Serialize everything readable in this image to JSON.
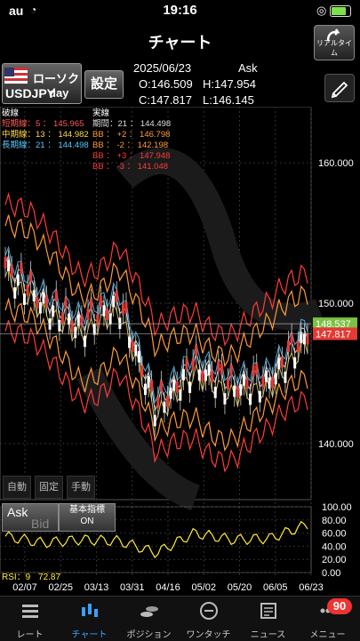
{
  "status": {
    "carrier": "au",
    "time": "19:16"
  },
  "header": {
    "title": "チャート",
    "realtime_label": "リアルタイム"
  },
  "info": {
    "symbol": "USDJPY",
    "chart_type": "ローソク",
    "period": "day",
    "settings_label": "設定",
    "date": "2025/06/23",
    "side": "Ask",
    "open": "O:146.509",
    "high": "H:147.954",
    "close": "C:147.817",
    "low": "L:146.145"
  },
  "legend_left": {
    "title": "破線",
    "items": [
      {
        "label": "短期線：5 ： 145.965",
        "color": "#ff5a5a"
      },
      {
        "label": "中期線：13 ： 144.982",
        "color": "#ffd84a"
      },
      {
        "label": "長期線：21 ： 144.498",
        "color": "#5ac8ff"
      }
    ]
  },
  "legend_right": {
    "title": "実線",
    "items": [
      {
        "label": "期間：21 ： 144.498",
        "color": "#dddddd"
      },
      {
        "label": "BB ： +2 ： 146.798",
        "color": "#ff9a3c"
      },
      {
        "label": "BB ： -2 ： 142.198",
        "color": "#ff9a3c"
      },
      {
        "label": "BB ： +3 ： 147.948",
        "color": "#ff3b3b"
      },
      {
        "label": "BB ： -3 ： 141.048",
        "color": "#ff3b3b"
      }
    ]
  },
  "price_axis": {
    "ticks": [
      {
        "value": 160,
        "label": "160.000"
      },
      {
        "value": 150,
        "label": "150.000"
      },
      {
        "value": 140,
        "label": "140.000"
      }
    ],
    "markers": [
      {
        "value": 148.537,
        "label": "148.537",
        "color": "#7bc142"
      },
      {
        "value": 147.817,
        "label": "147.817",
        "color": "#e53935"
      }
    ]
  },
  "date_axis": [
    "02/07",
    "02/25",
    "03/13",
    "03/31",
    "04/16",
    "05/02",
    "05/20",
    "06/05",
    "06/23"
  ],
  "mode_buttons": [
    "自動",
    "固定",
    "手動"
  ],
  "rsi_panel": {
    "ask_label": "Ask",
    "bid_label": "Bid",
    "indicator_label": "基本指標",
    "indicator_state": "ON",
    "rsi_period_label": "RSI：9",
    "rsi_value": "72.87",
    "ticks": [
      "100.00",
      "80.00",
      "60.00",
      "40.00",
      "20.00",
      "0.00"
    ]
  },
  "chart_data": {
    "type": "candlestick",
    "x": [
      "02/07",
      "02/25",
      "03/13",
      "03/31",
      "04/16",
      "05/02",
      "05/20",
      "06/05",
      "06/23"
    ],
    "ylim": [
      136,
      164
    ],
    "close_approx": [
      152.5,
      150.0,
      148.3,
      150.0,
      142.5,
      145.5,
      144.0,
      144.5,
      147.817
    ],
    "rsi_approx": [
      55,
      45,
      50,
      48,
      30,
      60,
      50,
      52,
      72.87
    ],
    "rsi_ylim": [
      0,
      100
    ]
  },
  "tabs": [
    {
      "label": "レート",
      "icon": "list-icon"
    },
    {
      "label": "チャート",
      "icon": "candlestick-icon",
      "active": true
    },
    {
      "label": "ポジション",
      "icon": "coins-icon"
    },
    {
      "label": "ワンタッチ",
      "icon": "sell-buy-icon"
    },
    {
      "label": "ニュース",
      "icon": "news-icon"
    },
    {
      "label": "メニュー",
      "icon": "menu-icon",
      "badge": "90"
    }
  ]
}
